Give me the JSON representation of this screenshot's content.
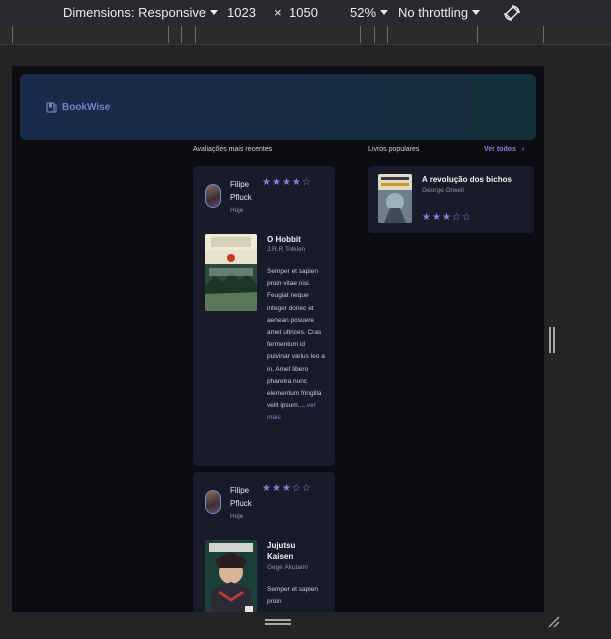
{
  "devtools": {
    "dimensions_label": "Dimensions: Responsive",
    "width": "1023",
    "times": "×",
    "height": "1050",
    "zoom": "52%",
    "throttling": "No throttling"
  },
  "app": {
    "logo_text": "BookWise"
  },
  "recent_reviews": {
    "title": "Avaliações mais recentes",
    "items": [
      {
        "user": "Filipe Pfluck",
        "date": "Hoje",
        "rating": 4,
        "book_title": "O Hobbit",
        "book_author": "J.R.R Tolkien",
        "description": "Semper et sapien proin vitae nisi. Feugiat neque integer donec et aenean posuere amet ultrices. Cras fermentum id pulvinar varius leo a in. Amet libero pharetra nunc elementum fringilla velit ipsum....",
        "more_label": "ver mais"
      },
      {
        "user": "Filipe Pfluck",
        "date": "Hoje",
        "rating": 3,
        "book_title": "Jujutsu Kaisen",
        "book_author": "Gege Akutami",
        "description": "Semper et sapien proin"
      }
    ]
  },
  "popular": {
    "title": "Livros populares",
    "see_all": "Ver todos",
    "items": [
      {
        "book_title": "A revolução dos bichos",
        "book_author": "George Orwell",
        "rating": 3
      }
    ]
  },
  "colors": {
    "accent": "#8381d9",
    "page_bg": "#0b0d12",
    "card_bg": "#181c2a"
  }
}
